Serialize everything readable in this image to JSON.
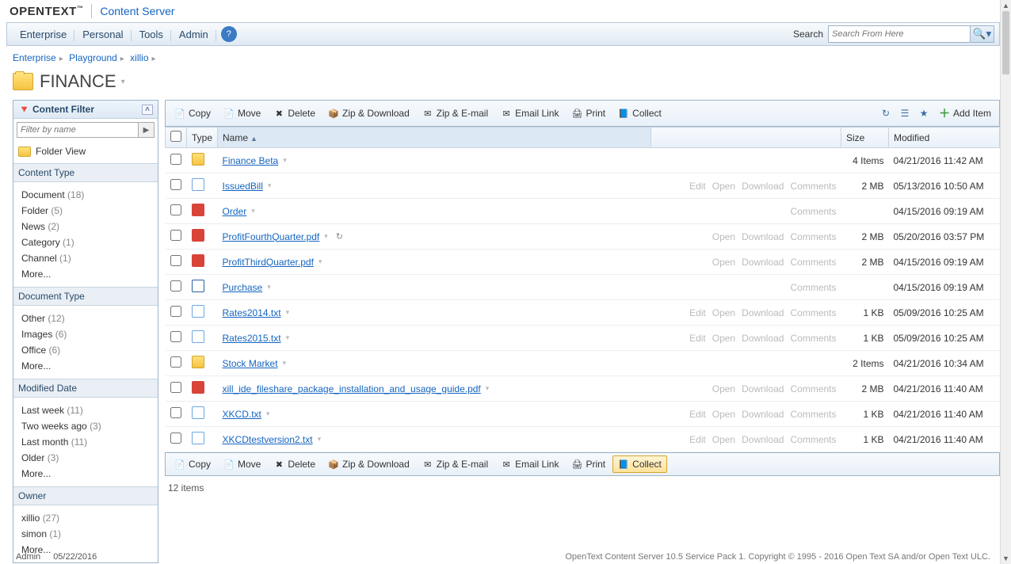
{
  "brand": {
    "logo": "OPENTEXT",
    "tm": "™",
    "app": "Content Server"
  },
  "nav": {
    "items": [
      "Enterprise",
      "Personal",
      "Tools",
      "Admin"
    ],
    "help_tooltip": "?",
    "search_label": "Search",
    "search_placeholder": "Search From Here"
  },
  "breadcrumb": [
    "Enterprise",
    "Playground",
    "xillio"
  ],
  "page_title": "FINANCE",
  "sidebar": {
    "filter_title": "Content Filter",
    "filter_placeholder": "Filter by name",
    "folder_view": "Folder View",
    "sections": [
      {
        "title": "Content Type",
        "items": [
          {
            "label": "Document",
            "count": "(18)"
          },
          {
            "label": "Folder",
            "count": "(5)"
          },
          {
            "label": "News",
            "count": "(2)"
          },
          {
            "label": "Category",
            "count": "(1)"
          },
          {
            "label": "Channel",
            "count": "(1)"
          }
        ],
        "more": "More..."
      },
      {
        "title": "Document Type",
        "items": [
          {
            "label": "Other",
            "count": "(12)"
          },
          {
            "label": "Images",
            "count": "(6)"
          },
          {
            "label": "Office",
            "count": "(6)"
          }
        ],
        "more": "More..."
      },
      {
        "title": "Modified Date",
        "items": [
          {
            "label": "Last week",
            "count": "(11)"
          },
          {
            "label": "Two weeks ago",
            "count": "(3)"
          },
          {
            "label": "Last month",
            "count": "(11)"
          },
          {
            "label": "Older",
            "count": "(3)"
          }
        ],
        "more": "More..."
      },
      {
        "title": "Owner",
        "items": [
          {
            "label": "xillio",
            "count": "(27)"
          },
          {
            "label": "simon",
            "count": "(1)"
          }
        ],
        "more": "More..."
      }
    ]
  },
  "toolbar": {
    "buttons": [
      "Copy",
      "Move",
      "Delete",
      "Zip & Download",
      "Zip & E-mail",
      "Email Link",
      "Print",
      "Collect"
    ],
    "add_item": "Add Item"
  },
  "columns": {
    "type": "Type",
    "name": "Name",
    "size": "Size",
    "modified": "Modified"
  },
  "rows": [
    {
      "icon": "folder",
      "name": "Finance Beta",
      "actions": [],
      "size": "4 Items",
      "modified": "04/21/2016 11:42 AM"
    },
    {
      "icon": "doc",
      "name": "IssuedBill",
      "actions": [
        "Edit",
        "Open",
        "Download",
        "Comments"
      ],
      "size": "2 MB",
      "modified": "05/13/2016 10:50 AM"
    },
    {
      "icon": "pdf",
      "name": "Order",
      "actions": [
        "Comments"
      ],
      "size": "",
      "modified": "04/15/2016 09:19 AM"
    },
    {
      "icon": "pdf",
      "name": "ProfitFourthQuarter.pdf",
      "actions": [
        "Open",
        "Download",
        "Comments"
      ],
      "size": "2 MB",
      "modified": "05/20/2016 03:57 PM",
      "reload": true
    },
    {
      "icon": "pdf",
      "name": "ProfitThirdQuarter.pdf",
      "actions": [
        "Open",
        "Download",
        "Comments"
      ],
      "size": "2 MB",
      "modified": "04/15/2016 09:19 AM"
    },
    {
      "icon": "word",
      "name": "Purchase",
      "actions": [
        "Comments"
      ],
      "size": "",
      "modified": "04/15/2016 09:19 AM"
    },
    {
      "icon": "doc",
      "name": "Rates2014.txt",
      "actions": [
        "Edit",
        "Open",
        "Download",
        "Comments"
      ],
      "size": "1 KB",
      "modified": "05/09/2016 10:25 AM"
    },
    {
      "icon": "doc",
      "name": "Rates2015.txt",
      "actions": [
        "Edit",
        "Open",
        "Download",
        "Comments"
      ],
      "size": "1 KB",
      "modified": "05/09/2016 10:25 AM"
    },
    {
      "icon": "folder",
      "name": "Stock Market",
      "actions": [],
      "size": "2 Items",
      "modified": "04/21/2016 10:34 AM"
    },
    {
      "icon": "pdf",
      "name": "xill_ide_fileshare_package_installation_and_usage_guide.pdf",
      "actions": [
        "Open",
        "Download",
        "Comments"
      ],
      "size": "2 MB",
      "modified": "04/21/2016 11:40 AM"
    },
    {
      "icon": "doc",
      "name": "XKCD.txt",
      "actions": [
        "Edit",
        "Open",
        "Download",
        "Comments"
      ],
      "size": "1 KB",
      "modified": "04/21/2016 11:40 AM"
    },
    {
      "icon": "doc",
      "name": "XKCDtestversion2.txt",
      "actions": [
        "Edit",
        "Open",
        "Download",
        "Comments"
      ],
      "size": "1 KB",
      "modified": "04/21/2016 11:40 AM"
    }
  ],
  "item_count": "12 items",
  "footer": {
    "user": "Admin",
    "date": "05/22/2016",
    "copyright": "OpenText Content Server 10.5 Service Pack 1. Copyright © 1995 - 2016 Open Text SA and/or Open Text ULC."
  }
}
